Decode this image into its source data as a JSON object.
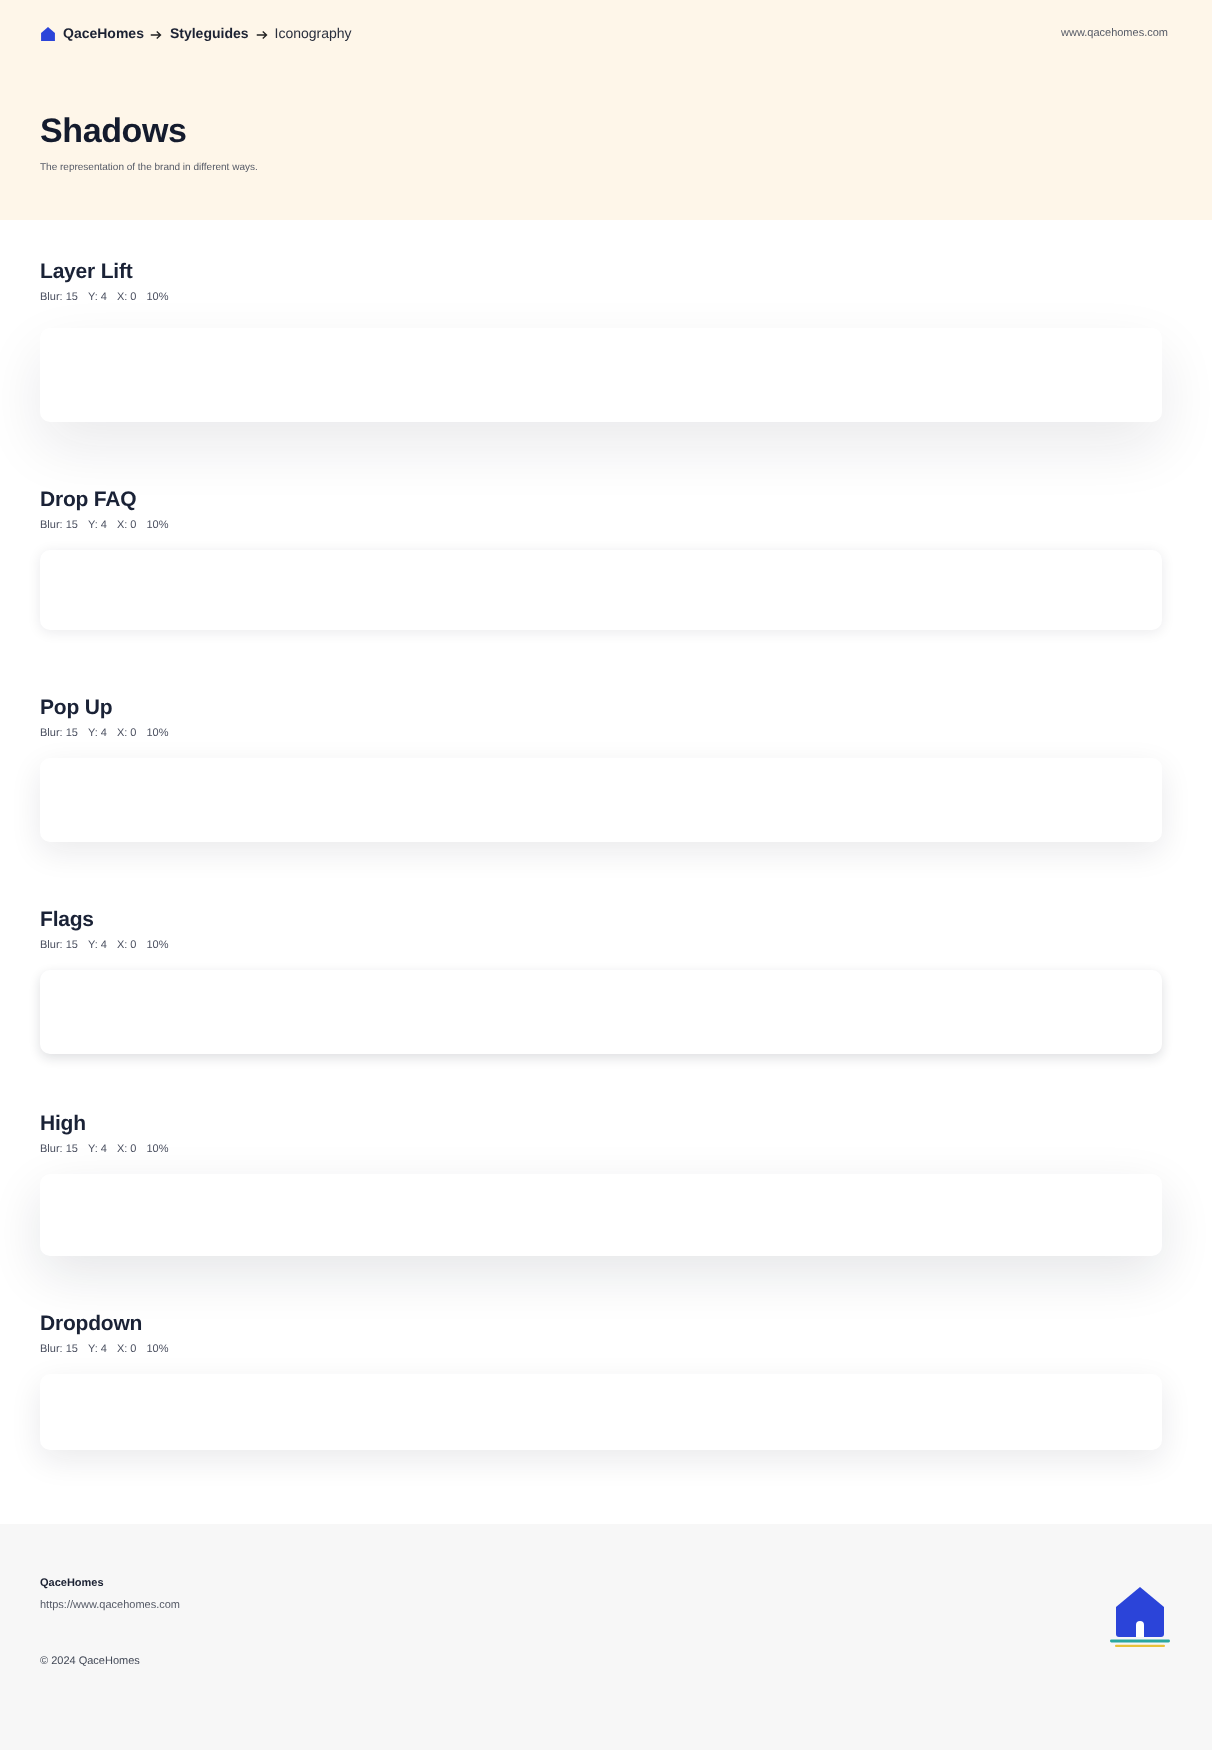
{
  "header": {
    "breadcrumb": [
      {
        "label": "QaceHomes",
        "current": false
      },
      {
        "label": "Styleguides",
        "current": false
      },
      {
        "label": "Iconography",
        "current": true
      }
    ],
    "site_link": "www.qacehomes.com",
    "title": "Shadows",
    "subtitle": "The representation of the brand in different ways."
  },
  "shadows": [
    {
      "name": "Layer Lift",
      "kind": "lift",
      "settings": [
        "Blur: 15",
        "Y: 4",
        "X: 0",
        "10%"
      ]
    },
    {
      "name": "Drop FAQ",
      "kind": "faq",
      "settings": [
        "Blur: 15",
        "Y: 4",
        "X: 0",
        "10%"
      ]
    },
    {
      "name": "Pop Up",
      "kind": "popup",
      "settings": [
        "Blur: 15",
        "Y: 4",
        "X: 0",
        "10%"
      ]
    },
    {
      "name": "Flags",
      "kind": "flag",
      "settings": [
        "Blur: 15",
        "Y: 4",
        "X: 0",
        "10%"
      ]
    },
    {
      "name": "High",
      "kind": "high",
      "settings": [
        "Blur: 15",
        "Y: 4",
        "X: 0",
        "10%"
      ]
    },
    {
      "name": "Dropdown",
      "kind": "dropdown",
      "settings": [
        "Blur: 15",
        "Y: 4",
        "X: 0",
        "10%"
      ]
    }
  ],
  "footer": {
    "brand": "QaceHomes",
    "url": "https://www.qacehomes.com",
    "copyright": "© 2024 QaceHomes"
  }
}
